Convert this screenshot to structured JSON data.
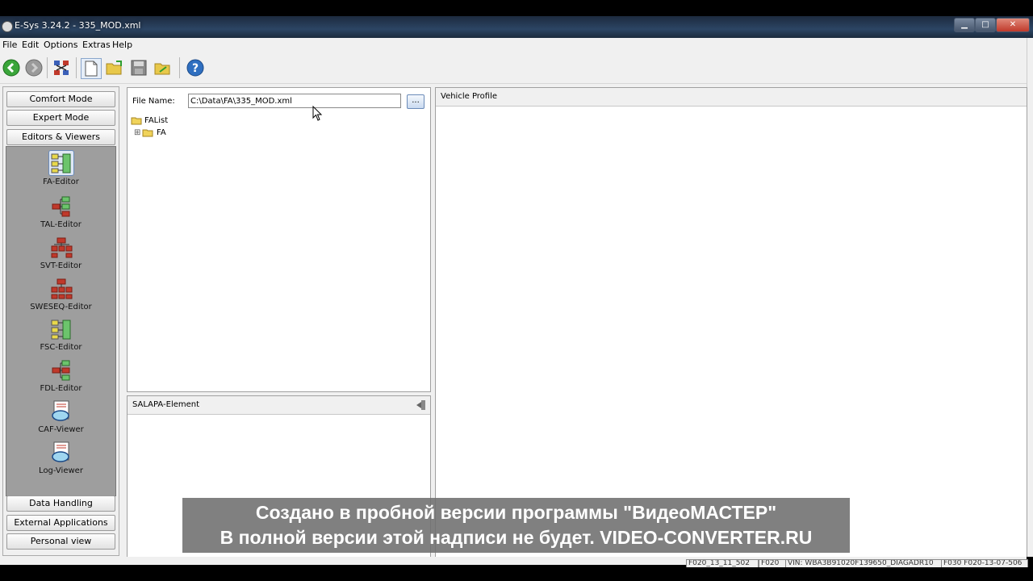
{
  "window": {
    "title": "E-Sys 3.24.2 - 335_MOD.xml",
    "controls": [
      "minimize",
      "maximize",
      "close"
    ]
  },
  "menu": [
    "File",
    "Edit",
    "Options",
    "Extras",
    "Help"
  ],
  "toolbar": {
    "icons": [
      "connect-icon",
      "disconnect-icon",
      "network-icon",
      "new-file-icon",
      "open-folder-icon",
      "save-icon",
      "folder-export-icon",
      "help-icon"
    ]
  },
  "sidebar": {
    "top_buttons": [
      "Comfort Mode",
      "Expert Mode",
      "Editors & Viewers"
    ],
    "tools": [
      {
        "label": "FA-Editor",
        "icon": "fa-editor-icon",
        "selected": true
      },
      {
        "label": "TAL-Editor",
        "icon": "tal-editor-icon",
        "selected": false
      },
      {
        "label": "SVT-Editor",
        "icon": "svt-editor-icon",
        "selected": false
      },
      {
        "label": "SWESEQ-Editor",
        "icon": "sweseq-editor-icon",
        "selected": false
      },
      {
        "label": "FSC-Editor",
        "icon": "fsc-editor-icon",
        "selected": false
      },
      {
        "label": "FDL-Editor",
        "icon": "fdl-editor-icon",
        "selected": false
      },
      {
        "label": "CAF-Viewer",
        "icon": "caf-viewer-icon",
        "selected": false
      },
      {
        "label": "Log-Viewer",
        "icon": "log-viewer-icon",
        "selected": false
      }
    ],
    "bottom_buttons": [
      "Data Handling",
      "External Applications",
      "Personal view"
    ]
  },
  "file_panel": {
    "label": "File Name:",
    "value": "C:\\Data\\FA\\335_MOD.xml",
    "browse_label": "...",
    "tree": [
      {
        "label": "FAList",
        "expander": ""
      },
      {
        "label": "FA",
        "expander": "⊞"
      }
    ]
  },
  "salapa_panel": {
    "title": "SALAPA-Element"
  },
  "vehicle_panel": {
    "title": "Vehicle Profile"
  },
  "status": [
    "F020_13_11_502",
    "F020",
    "VIN: WBA3B91020F139650_DIAGADR10",
    "F030 F020-13-07-506"
  ],
  "watermark": {
    "line1": "Создано в пробной версии программы \"ВидеоМАСТЕР\"",
    "line2": "В полной версии этой надписи не будет. VIDEO-CONVERTER.RU"
  },
  "colors": {
    "titlebar": "#2c4564",
    "window_bg": "#f0f0f0",
    "viewer_area": "#9e9e9e",
    "watermark_bg": "#6e6e6e"
  }
}
